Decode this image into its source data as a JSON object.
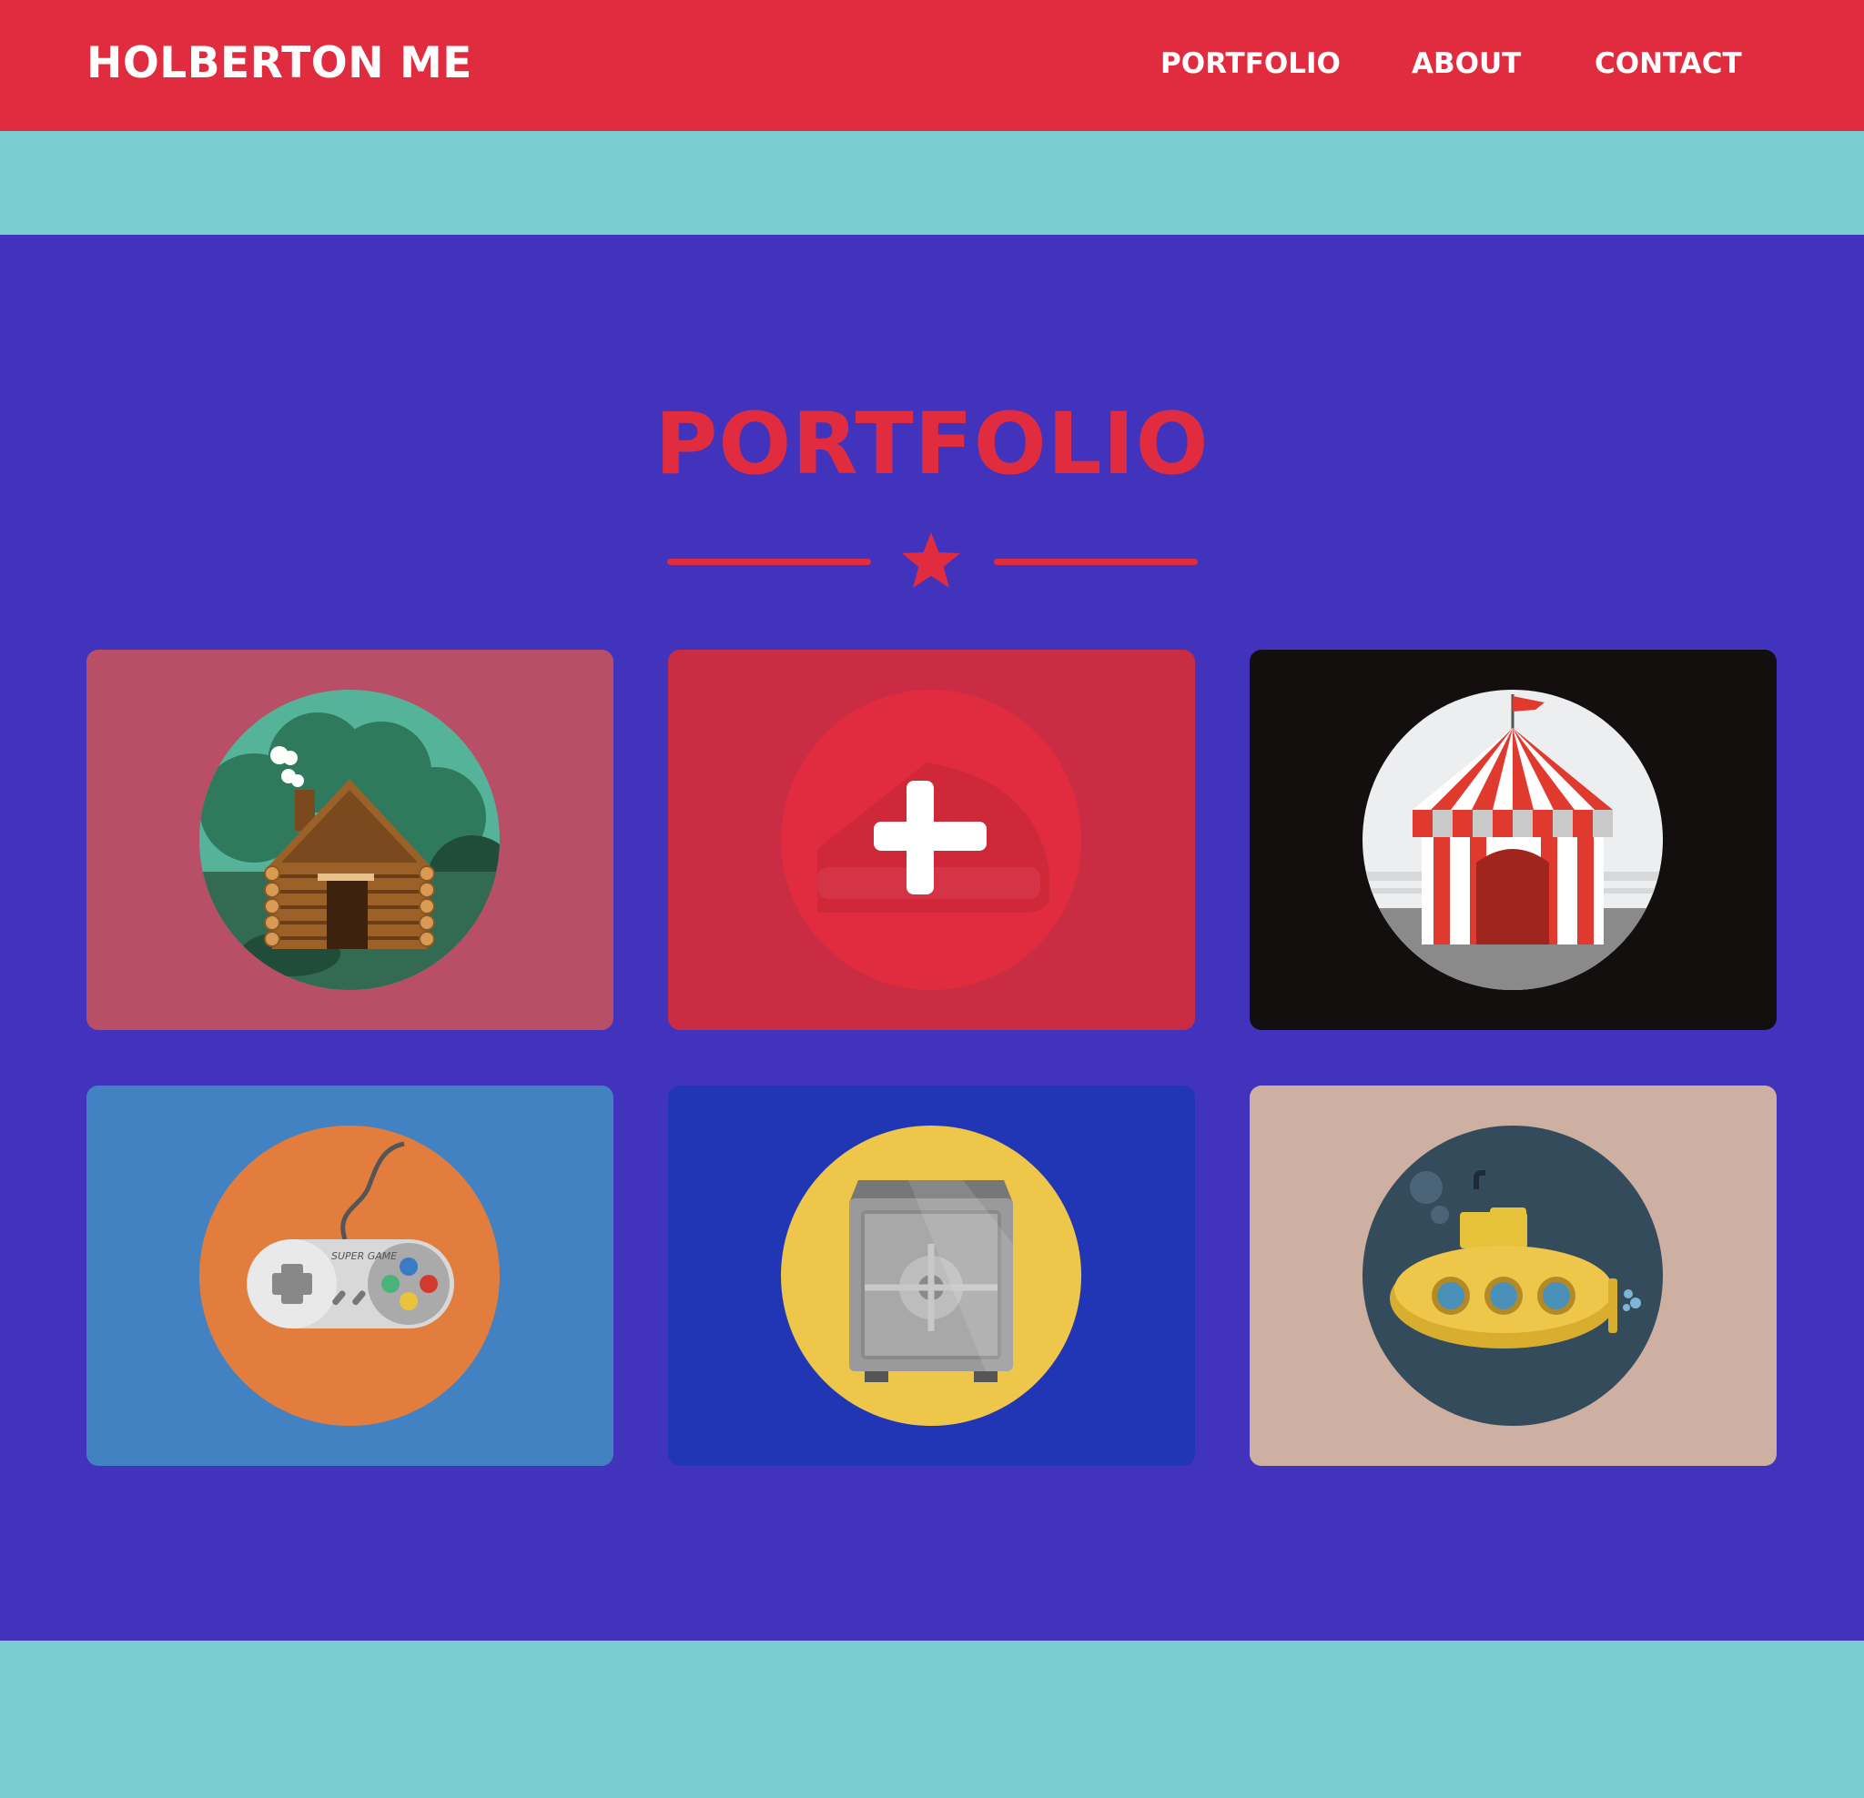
{
  "navbar": {
    "brand": "HOLBERTON ME",
    "links": [
      "PORTFOLIO",
      "ABOUT",
      "CONTACT"
    ]
  },
  "portfolio": {
    "title": "PORTFOLIO",
    "items": [
      {
        "name": "cabin",
        "icon": "log-cabin-icon",
        "bg": "#b94f66"
      },
      {
        "name": "cake",
        "icon": "cake-icon",
        "bg": "#c92c43"
      },
      {
        "name": "circus",
        "icon": "circus-tent-icon",
        "bg": "#130f0e"
      },
      {
        "name": "game",
        "icon": "game-controller-icon",
        "bg": "#4282c3"
      },
      {
        "name": "safe",
        "icon": "safe-icon",
        "bg": "#2036b4"
      },
      {
        "name": "submarine",
        "icon": "submarine-icon",
        "bg": "#cdb0a2"
      }
    ],
    "controller_label": "SUPER GAME"
  },
  "colors": {
    "navbar": "#e02c3e",
    "band": "#78cdd2",
    "main": "#4233bc",
    "accent": "#e02c3e"
  }
}
